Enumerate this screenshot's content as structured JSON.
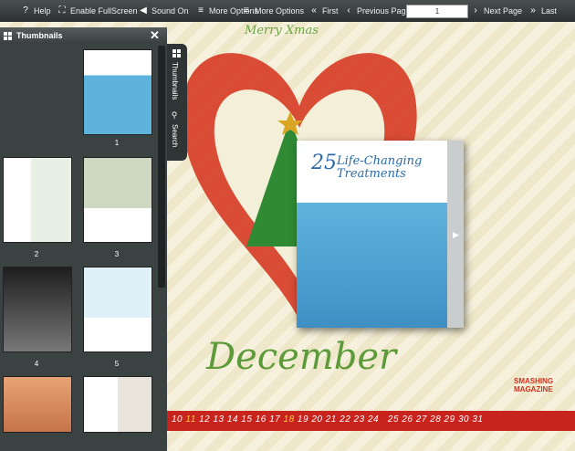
{
  "toolbar": {
    "help": "Help",
    "fullscreen": "Enable FullScreen",
    "sound": "Sound On",
    "more_options_1": "More Options",
    "more_options_2": "More Options",
    "first": "First",
    "previous": "Previous Page",
    "page_value": "1",
    "next": "Next Page",
    "last": "Last"
  },
  "panel": {
    "title": "Thumbnails",
    "close": "✕",
    "thumbnails": [
      {
        "num": "1"
      },
      {
        "num": "2"
      },
      {
        "num": "3"
      },
      {
        "num": "4"
      },
      {
        "num": "5"
      }
    ]
  },
  "side_tabs": {
    "thumbnails": "Thumbnails",
    "search": "Search"
  },
  "scene": {
    "merry": "Merry Xmas",
    "month": "December",
    "brand": "SMASHING MAGAZINE",
    "days": [
      "10",
      "11",
      "12",
      "13",
      "14",
      "15",
      "16",
      "17",
      "18",
      "19",
      "20",
      "21",
      "22",
      "23",
      "24",
      "25",
      "26",
      "27",
      "28",
      "29",
      "30",
      "31"
    ]
  },
  "book": {
    "num": "25",
    "title_1": "Life-Changing",
    "title_2": "Treatments"
  },
  "colors": {
    "accent_red": "#c8231d",
    "green": "#5c9a3a",
    "panel": "#3b4242"
  }
}
